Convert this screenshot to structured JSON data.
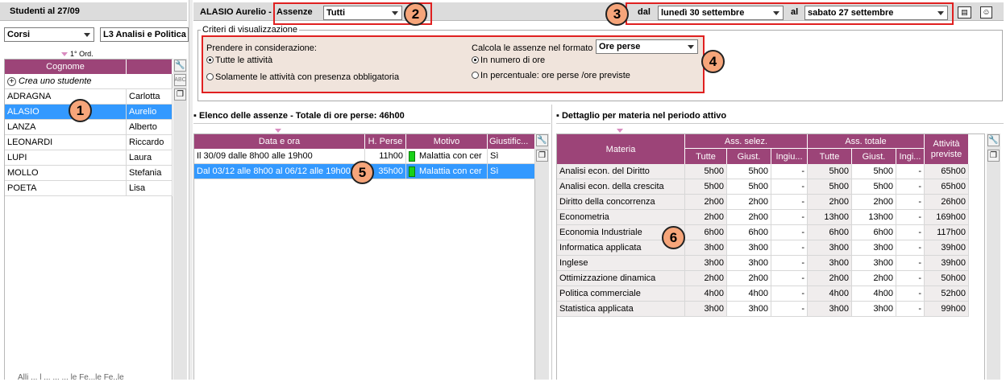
{
  "left": {
    "title": "Studenti al 27/09",
    "filter_type": "Corsi",
    "filter_course": "L3 Analisi e Politica",
    "sort_label": "1° Ord.",
    "col_surname": "Cognome",
    "create_label": "Crea uno studente",
    "students": [
      {
        "surname": "ADRAGNA",
        "name": "Carlotta"
      },
      {
        "surname": "ALASIO",
        "name": "Aurelio"
      },
      {
        "surname": "LANZA",
        "name": "Alberto"
      },
      {
        "surname": "LEONARDI",
        "name": "Riccardo"
      },
      {
        "surname": "LUPI",
        "name": "Laura"
      },
      {
        "surname": "MOLLO",
        "name": "Stefania"
      },
      {
        "surname": "POETA",
        "name": "Lisa"
      }
    ],
    "footer_text": "Alli ... l ... ... ... le Fe...le Fe..le"
  },
  "top": {
    "student": "ALASIO Aurelio -",
    "absences_label": "Assenze",
    "absences_value": "Tutti",
    "from_label": "dal",
    "from_value": "lunedì 30 settembre",
    "to_label": "al",
    "to_value": "sabato 27 settembre"
  },
  "criteria": {
    "title": "Criteri di visualizzazione",
    "consider_label": "Prendere in considerazione:",
    "opt_all": "Tutte le attività",
    "opt_mandatory": "Solamente le attività con presenza obbligatoria",
    "format_label": "Calcola le assenze nel formato",
    "format_value": "Ore perse",
    "opt_number": "In numero di ore",
    "opt_percent": "In percentuale: ore perse /ore previste"
  },
  "absences": {
    "title": "Elenco delle assenze - Totale di ore perse: 46h00",
    "headers": [
      "Data e ora",
      "H. Perse",
      "Motivo",
      "Giustific..."
    ],
    "rows": [
      {
        "date": "Il 30/09 dalle 8h00 alle 19h00",
        "hours": "11h00",
        "reason": "Malattia con cer",
        "just": "Sì"
      },
      {
        "date": "Dal 03/12 alle 8h00 al 06/12 alle 19h00",
        "hours": "35h00",
        "reason": "Malattia con cer",
        "just": "Sì"
      }
    ]
  },
  "detail": {
    "title": "Dettaglio per materia nel periodo attivo",
    "h_subject": "Materia",
    "h_sel": "Ass. selez.",
    "h_tot": "Ass. totale",
    "h_planned": "Attività previste",
    "sub_headers": [
      "Tutte",
      "Giust.",
      "Ingiu...",
      "Tutte",
      "Giust.",
      "Ingi..."
    ],
    "rows": [
      [
        "Analisi econ. del Diritto",
        "5h00",
        "5h00",
        "-",
        "5h00",
        "5h00",
        "-",
        "65h00"
      ],
      [
        "Analisi econ. della crescita",
        "5h00",
        "5h00",
        "-",
        "5h00",
        "5h00",
        "-",
        "65h00"
      ],
      [
        "Diritto della concorrenza",
        "2h00",
        "2h00",
        "-",
        "2h00",
        "2h00",
        "-",
        "26h00"
      ],
      [
        "Econometria",
        "2h00",
        "2h00",
        "-",
        "13h00",
        "13h00",
        "-",
        "169h00"
      ],
      [
        "Economia Industriale",
        "6h00",
        "6h00",
        "-",
        "6h00",
        "6h00",
        "-",
        "117h00"
      ],
      [
        "Informatica applicata",
        "3h00",
        "3h00",
        "-",
        "3h00",
        "3h00",
        "-",
        "39h00"
      ],
      [
        "Inglese",
        "3h00",
        "3h00",
        "-",
        "3h00",
        "3h00",
        "-",
        "39h00"
      ],
      [
        "Ottimizzazione dinamica",
        "2h00",
        "2h00",
        "-",
        "2h00",
        "2h00",
        "-",
        "50h00"
      ],
      [
        "Politica commerciale",
        "4h00",
        "4h00",
        "-",
        "4h00",
        "4h00",
        "-",
        "52h00"
      ],
      [
        "Statistica applicata",
        "3h00",
        "3h00",
        "-",
        "3h00",
        "3h00",
        "-",
        "99h00"
      ]
    ]
  },
  "badges": [
    "1",
    "2",
    "3",
    "4",
    "5",
    "6"
  ],
  "colors": {
    "header": "#9c4478",
    "selected": "#3399ff",
    "badge": "#f6a57a",
    "panel": "#f0e4dc",
    "highlight_border": "#e02020"
  }
}
